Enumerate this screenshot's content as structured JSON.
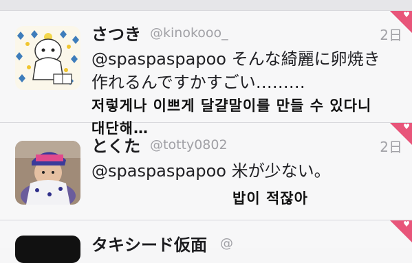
{
  "timeline": {
    "tweets": [
      {
        "display_name": "さつき",
        "handle": "@kinokooo_",
        "time": "2日",
        "line1": "@spaspaspapoo そんな綺麗に卵焼き",
        "line2": "作れるんですかすごい………",
        "favorited": true
      },
      {
        "display_name": "とくた",
        "handle": "@totty0802",
        "time": "2日",
        "line1": "@spaspaspapoo 米が少ない。",
        "favorited": true
      },
      {
        "display_name": "タキシード仮面",
        "handle": "@",
        "favorited": true
      }
    ]
  },
  "overlays": {
    "translation_1_line1": "저렇게나 이쁘게 달걀말이를 만들 수 있다니",
    "translation_1_line2": "대단해…",
    "translation_2": "밥이 적잖아"
  },
  "colors": {
    "favorite_corner": "#e8557a",
    "background": "#f7f7f8",
    "secondary_text": "#a1a1a6"
  },
  "icons": [
    "heart-icon",
    "avatar"
  ]
}
